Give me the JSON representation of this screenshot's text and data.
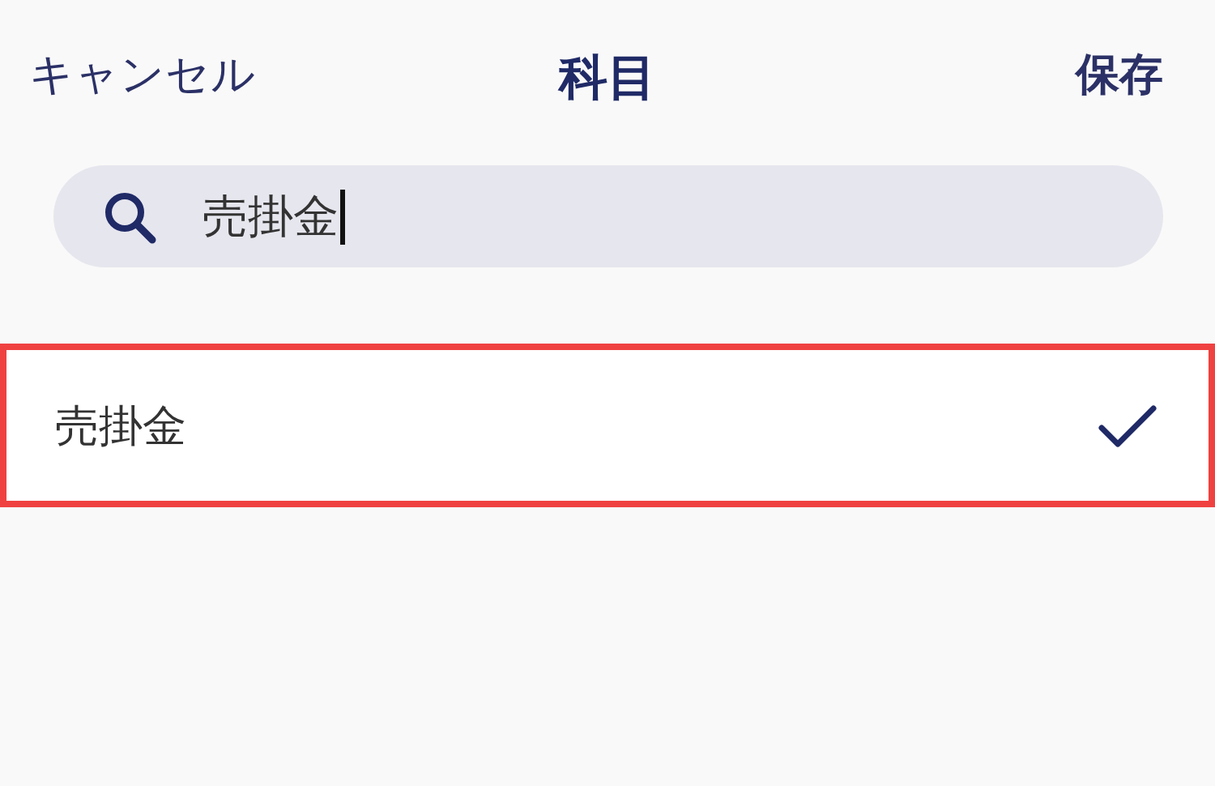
{
  "header": {
    "cancel": "キャンセル",
    "title": "科目",
    "save": "保存"
  },
  "search": {
    "value": "売掛金",
    "focused": true
  },
  "results": [
    {
      "label": "売掛金",
      "selected": true,
      "highlighted": true
    }
  ]
}
